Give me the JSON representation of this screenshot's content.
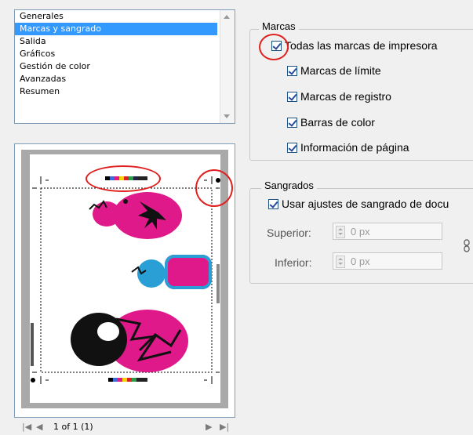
{
  "categories": [
    "Generales",
    "Marcas y sangrado",
    "Salida",
    "Gráficos",
    "Gestión de color",
    "Avanzadas",
    "Resumen"
  ],
  "selected_category": "Marcas y sangrado",
  "marcas": {
    "legend": "Marcas",
    "all_marks": "Todas las marcas de impresora",
    "crop_marks": "Marcas de límite",
    "registration_marks": "Marcas de registro",
    "color_bars": "Barras de color",
    "page_info": "Información de página"
  },
  "sangrados": {
    "legend": "Sangrados",
    "use_doc_bleed": "Usar ajustes de sangrado de docu",
    "top_label": "Superior:",
    "top_value": "0 px",
    "bottom_label": "Inferior:",
    "bottom_value": "0 px"
  },
  "nav": {
    "page_status": "1 of 1 (1)"
  },
  "colors": {
    "selection": "#3399ff",
    "highlight_circle": "#e02020",
    "doll_pink": "#e0198a",
    "doll_blue": "#2a9fd6"
  }
}
